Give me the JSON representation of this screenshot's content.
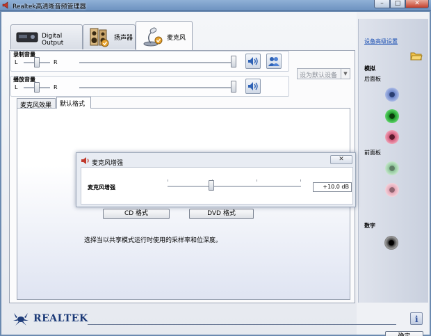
{
  "window": {
    "title": "Realtek高清晰音频管理器",
    "min_glyph": "–",
    "max_glyph": "□",
    "close_glyph": "✕"
  },
  "device_tabs": [
    {
      "label": "Digital Output",
      "icon": "digital-output-icon",
      "active": false
    },
    {
      "label": "扬声器",
      "icon": "speaker-icon",
      "active": false
    },
    {
      "label": "麦克风",
      "icon": "microphone-icon",
      "active": true
    }
  ],
  "recording_volume": {
    "label": "录制音量",
    "left": "L",
    "right": "R"
  },
  "playback_volume": {
    "label": "播放音量",
    "left": "L",
    "right": "R"
  },
  "default_device": {
    "label": "设为默认设备",
    "arrow": "▼"
  },
  "inner_tabs": [
    {
      "label": "麦克风效果",
      "active": false
    },
    {
      "label": "默认格式",
      "active": true
    }
  ],
  "format_buttons": {
    "cd": "CD 格式",
    "dvd": "DVD 格式"
  },
  "info_text": "选择当以共享模式运行时使用的采样率和位深度。",
  "boost_popup": {
    "title": "麦克风增强",
    "close_glyph": "✕",
    "slider_label": "麦克风增强",
    "value": "+10.0 dB",
    "level_fraction": 0.33
  },
  "right_pane": {
    "advanced_link": "设备高级设置",
    "analog": "模拟",
    "back_panel": "后面板",
    "front_panel": "前面板",
    "digital": "数字",
    "jack_colors": {
      "blue": "#6f87c9",
      "green": "#1f9a2b",
      "pink": "#d25b7c",
      "green_inactive": "#8fc69a",
      "pink_inactive": "#e3a6b6",
      "black": "#222222"
    }
  },
  "footer": {
    "brand": "REALTEK",
    "ok": "确定",
    "info_glyph": "i"
  },
  "colors": {
    "accent": "#1c3a78",
    "link": "#1a4fb3"
  }
}
